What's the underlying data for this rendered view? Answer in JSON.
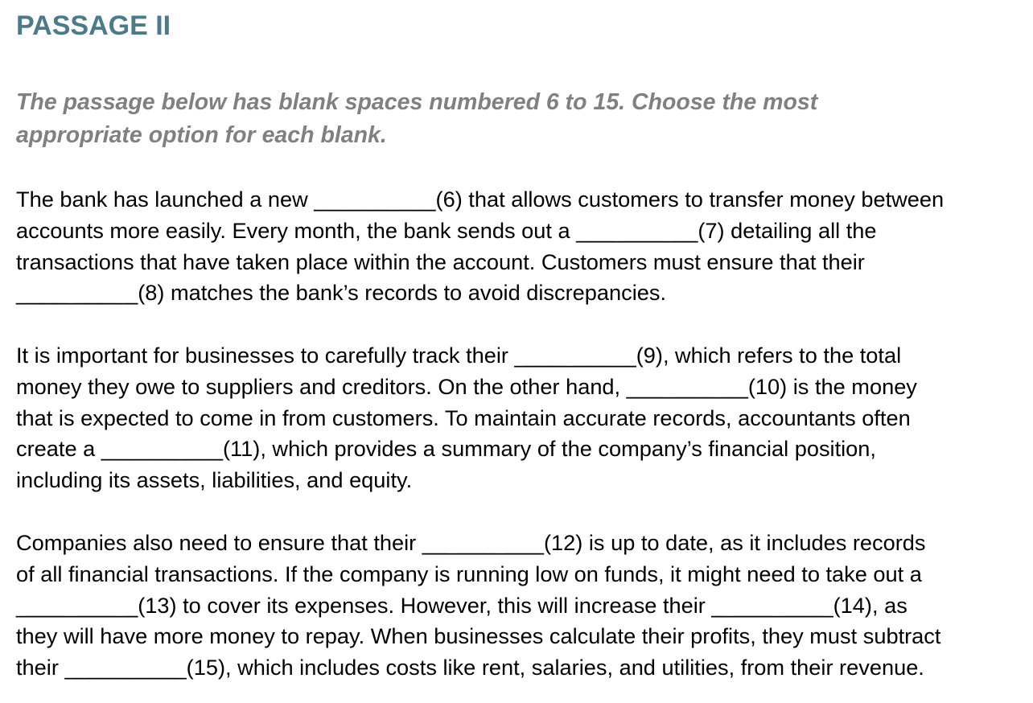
{
  "passage": {
    "heading": "PASSAGE II",
    "instructions": [
      "The passage below has blank spaces numbered 6 to 15. Choose the most",
      "appropriate option for each blank."
    ],
    "paragraphs": [
      [
        "The bank has launched a new __________(6) that allows customers to transfer money between",
        "accounts more easily. Every month, the bank sends out a __________(7) detailing all the",
        "transactions that have taken place within the account. Customers must ensure that their",
        "__________(8) matches the bank’s records to avoid discrepancies."
      ],
      [
        "It is important for businesses to carefully track their __________(9), which refers to the total",
        "money they owe to suppliers and creditors. On the other hand, __________(10) is the money",
        "that is expected to come in from customers. To maintain accurate records, accountants often",
        "create a __________(11), which provides a summary of the company’s financial position,",
        "including its assets, liabilities, and equity."
      ],
      [
        "Companies also need to ensure that their __________(12) is up to date, as it includes records",
        "of all financial transactions. If the company is running low on funds, it might need to take out a",
        "__________(13) to cover its expenses. However, this will increase their __________(14), as",
        "they will have more money to repay. When businesses calculate their profits, they must subtract",
        "their __________(15), which includes costs like rent, salaries, and utilities, from their revenue."
      ]
    ]
  }
}
